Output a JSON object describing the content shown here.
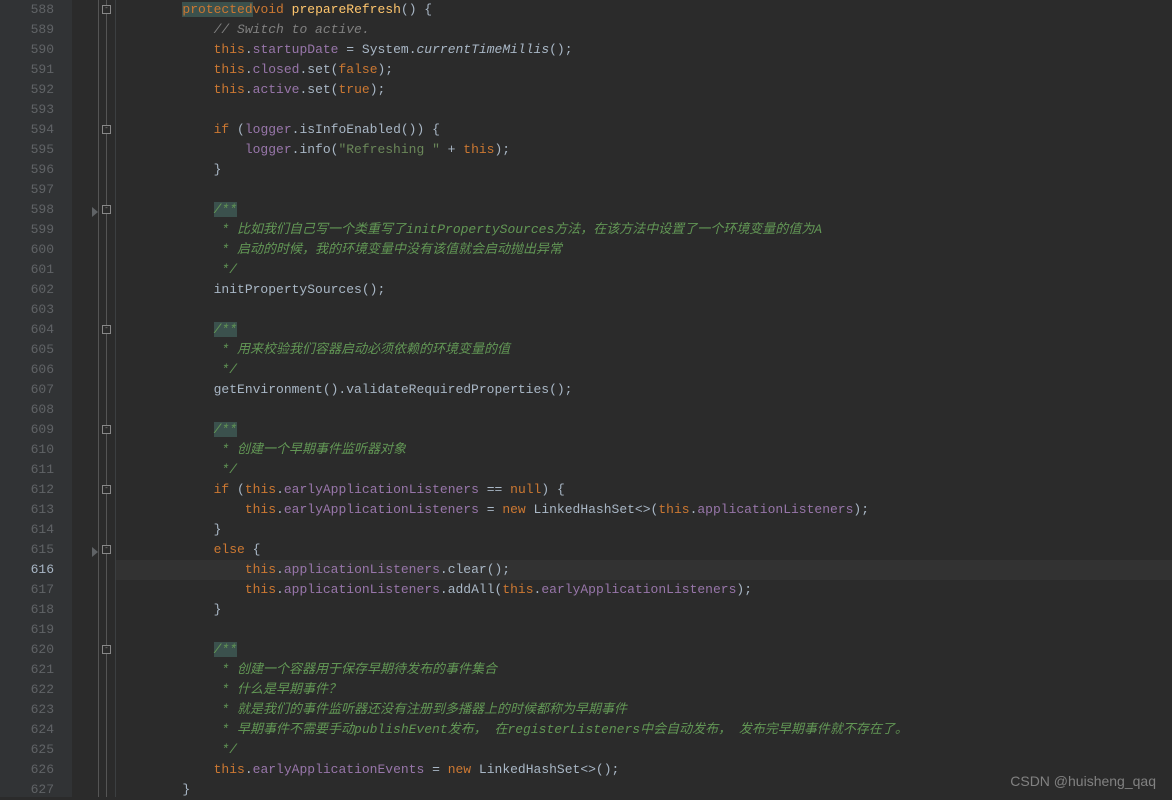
{
  "lineStart": 588,
  "lineEnd": 627,
  "currentLine": 616,
  "watermark": "CSDN @huisheng_qaq",
  "code": {
    "l588": {
      "indent": "        ",
      "tokens": [
        [
          "kw hl-bg",
          "protected"
        ],
        [
          "",
          "",
          " "
        ],
        [
          "kw",
          "void"
        ],
        [
          "",
          " "
        ],
        [
          "method",
          "prepareRefresh"
        ],
        [
          "",
          "() {"
        ]
      ]
    },
    "l589": {
      "indent": "            ",
      "tokens": [
        [
          "comment",
          "// Switch to active."
        ]
      ]
    },
    "l590": {
      "indent": "            ",
      "tokens": [
        [
          "kw",
          "this"
        ],
        [
          "",
          "."
        ],
        [
          "field",
          "startupDate"
        ],
        [
          "",
          " = System."
        ],
        [
          "ital",
          "currentTimeMillis"
        ],
        [
          "",
          "();"
        ]
      ]
    },
    "l591": {
      "indent": "            ",
      "tokens": [
        [
          "kw",
          "this"
        ],
        [
          "",
          "."
        ],
        [
          "field",
          "closed"
        ],
        [
          "",
          ".set("
        ],
        [
          "kw",
          "false"
        ],
        [
          "",
          ");"
        ]
      ]
    },
    "l592": {
      "indent": "            ",
      "tokens": [
        [
          "kw",
          "this"
        ],
        [
          "",
          "."
        ],
        [
          "field",
          "active"
        ],
        [
          "",
          ".set("
        ],
        [
          "kw",
          "true"
        ],
        [
          "",
          ");"
        ]
      ]
    },
    "l593": {
      "indent": "",
      "tokens": []
    },
    "l594": {
      "indent": "            ",
      "tokens": [
        [
          "kw",
          "if"
        ],
        [
          "",
          " ("
        ],
        [
          "field",
          "logger"
        ],
        [
          "",
          ".isInfoEnabled()) {"
        ]
      ]
    },
    "l595": {
      "indent": "                ",
      "tokens": [
        [
          "field",
          "logger"
        ],
        [
          "",
          ".info("
        ],
        [
          "str",
          "\"Refreshing \""
        ],
        [
          "",
          " + "
        ],
        [
          "kw",
          "this"
        ],
        [
          "",
          ");"
        ]
      ]
    },
    "l596": {
      "indent": "            ",
      "tokens": [
        [
          "",
          "}"
        ]
      ]
    },
    "l597": {
      "indent": "",
      "tokens": []
    },
    "l598": {
      "indent": "            ",
      "tokens": [
        [
          "doc-start",
          "/**"
        ]
      ]
    },
    "l599": {
      "indent": "             ",
      "tokens": [
        [
          "doc-comment",
          "* 比如我们自己写一个类重写了initPropertySources方法，在该方法中设置了一个环境变量的值为A"
        ]
      ]
    },
    "l600": {
      "indent": "             ",
      "tokens": [
        [
          "doc-comment",
          "* 启动的时候，我的环境变量中没有该值就会启动抛出异常"
        ]
      ]
    },
    "l601": {
      "indent": "             ",
      "tokens": [
        [
          "doc-comment",
          "*/"
        ]
      ]
    },
    "l602": {
      "indent": "            ",
      "tokens": [
        [
          "",
          "initPropertySources();"
        ]
      ]
    },
    "l603": {
      "indent": "",
      "tokens": []
    },
    "l604": {
      "indent": "            ",
      "tokens": [
        [
          "doc-start",
          "/**"
        ]
      ]
    },
    "l605": {
      "indent": "             ",
      "tokens": [
        [
          "doc-comment",
          "* 用来校验我们容器启动必须依赖的环境变量的值"
        ]
      ]
    },
    "l606": {
      "indent": "             ",
      "tokens": [
        [
          "doc-comment",
          "*/"
        ]
      ]
    },
    "l607": {
      "indent": "            ",
      "tokens": [
        [
          "",
          "getEnvironment().validateRequiredProperties();"
        ]
      ]
    },
    "l608": {
      "indent": "",
      "tokens": []
    },
    "l609": {
      "indent": "            ",
      "tokens": [
        [
          "doc-start",
          "/**"
        ]
      ]
    },
    "l610": {
      "indent": "             ",
      "tokens": [
        [
          "doc-comment",
          "* 创建一个早期事件监听器对象"
        ]
      ]
    },
    "l611": {
      "indent": "             ",
      "tokens": [
        [
          "doc-comment",
          "*/"
        ]
      ]
    },
    "l612": {
      "indent": "            ",
      "tokens": [
        [
          "kw",
          "if"
        ],
        [
          "",
          " ("
        ],
        [
          "kw",
          "this"
        ],
        [
          "",
          "."
        ],
        [
          "field",
          "earlyApplicationListeners"
        ],
        [
          "",
          " == "
        ],
        [
          "kw",
          "null"
        ],
        [
          "",
          ") {"
        ]
      ]
    },
    "l613": {
      "indent": "                ",
      "tokens": [
        [
          "kw",
          "this"
        ],
        [
          "",
          "."
        ],
        [
          "field",
          "earlyApplicationListeners"
        ],
        [
          "",
          " = "
        ],
        [
          "kw",
          "new"
        ],
        [
          "",
          " LinkedHashSet<>("
        ],
        [
          "kw",
          "this"
        ],
        [
          "",
          "."
        ],
        [
          "field",
          "applicationListeners"
        ],
        [
          "",
          ");"
        ]
      ]
    },
    "l614": {
      "indent": "            ",
      "tokens": [
        [
          "",
          "}"
        ]
      ]
    },
    "l615": {
      "indent": "            ",
      "tokens": [
        [
          "kw",
          "else"
        ],
        [
          "",
          " {"
        ]
      ]
    },
    "l616": {
      "indent": "                ",
      "tokens": [
        [
          "kw",
          "this"
        ],
        [
          "",
          "."
        ],
        [
          "field",
          "applicationListeners"
        ],
        [
          "",
          ".clear();"
        ]
      ]
    },
    "l617": {
      "indent": "                ",
      "tokens": [
        [
          "kw",
          "this"
        ],
        [
          "",
          "."
        ],
        [
          "field",
          "applicationListeners"
        ],
        [
          "",
          ".addAll("
        ],
        [
          "kw",
          "this"
        ],
        [
          "",
          "."
        ],
        [
          "field",
          "earlyApplicationListeners"
        ],
        [
          "",
          ");"
        ]
      ]
    },
    "l618": {
      "indent": "            ",
      "tokens": [
        [
          "",
          "}"
        ]
      ]
    },
    "l619": {
      "indent": "",
      "tokens": []
    },
    "l620": {
      "indent": "            ",
      "tokens": [
        [
          "doc-start",
          "/**"
        ]
      ]
    },
    "l621": {
      "indent": "             ",
      "tokens": [
        [
          "doc-comment",
          "* 创建一个容器用于保存早期待发布的事件集合"
        ]
      ]
    },
    "l622": {
      "indent": "             ",
      "tokens": [
        [
          "doc-comment",
          "* 什么是早期事件？"
        ]
      ]
    },
    "l623": {
      "indent": "             ",
      "tokens": [
        [
          "doc-comment",
          "* 就是我们的事件监听器还没有注册到多播器上的时候都称为早期事件"
        ]
      ]
    },
    "l624": {
      "indent": "             ",
      "tokens": [
        [
          "doc-comment",
          "* 早期事件不需要手动publishEvent发布， 在registerListeners中会自动发布， 发布完早期事件就不存在了。"
        ]
      ]
    },
    "l625": {
      "indent": "             ",
      "tokens": [
        [
          "doc-comment",
          "*/"
        ]
      ]
    },
    "l626": {
      "indent": "            ",
      "tokens": [
        [
          "kw",
          "this"
        ],
        [
          "",
          "."
        ],
        [
          "field",
          "earlyApplicationEvents"
        ],
        [
          "",
          " = "
        ],
        [
          "kw",
          "new"
        ],
        [
          "",
          " LinkedHashSet<>();"
        ]
      ]
    },
    "l627": {
      "indent": "        ",
      "tokens": [
        [
          "",
          "}"
        ]
      ]
    }
  }
}
